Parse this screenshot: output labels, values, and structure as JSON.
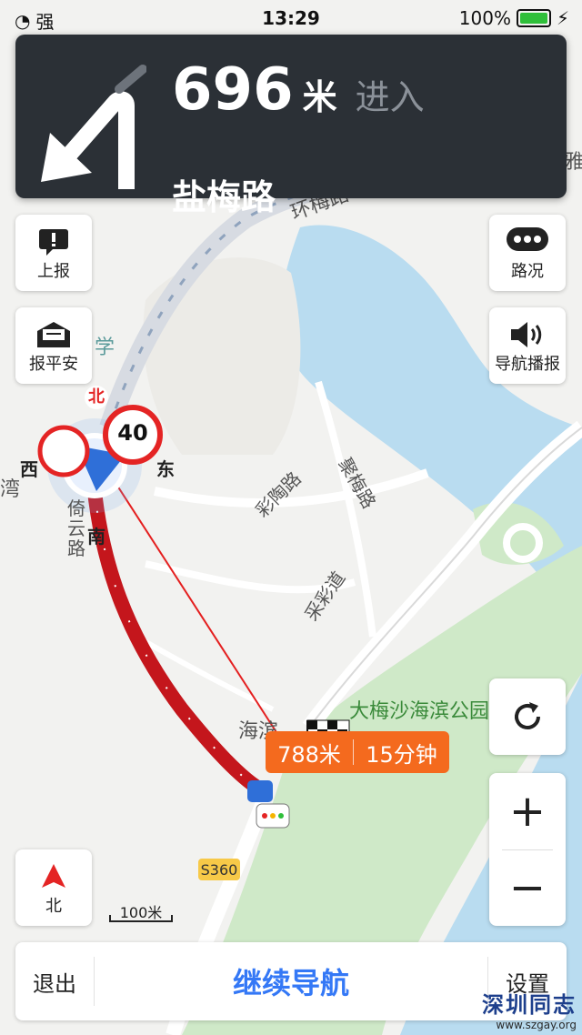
{
  "status_bar": {
    "signal_text": "强",
    "time": "13:29",
    "battery_percent": "100%"
  },
  "banner": {
    "distance": "696",
    "distance_unit": "米",
    "action": "进入",
    "road": "盐梅路"
  },
  "left_buttons": {
    "report": "上报",
    "safety": "报平安",
    "compass": "北"
  },
  "right_buttons": {
    "traffic": "路况",
    "voice": "导航播报"
  },
  "map_labels": {
    "huanmei_road": "环梅路",
    "caitao_road": "彩陶路",
    "yingmei_road": "聚梅路",
    "caicai_road": "采彩道",
    "qiyun_road": "倚云路",
    "park": "大梅沙海滨公园",
    "haibin": "海滨",
    "wan": "湾",
    "xue": "学",
    "ya": "雅",
    "highway": "S360"
  },
  "compass_dir": {
    "north": "北",
    "south": "南",
    "east": "东",
    "west": "西"
  },
  "speed_limit": "40",
  "eta": {
    "distance": "788米",
    "time": "15分钟"
  },
  "scale": "100米",
  "bottom": {
    "exit": "退出",
    "continue": "继续导航",
    "settings": "设置"
  },
  "watermark": {
    "title": "深圳同志",
    "url": "www.szgay.org"
  },
  "colors": {
    "route": "#c4161c",
    "eta_bubble": "#f46a1e",
    "banner": "#2b3036",
    "accent": "#3478f6",
    "water": "#b9dcf0",
    "green": "#cfe9c8"
  }
}
